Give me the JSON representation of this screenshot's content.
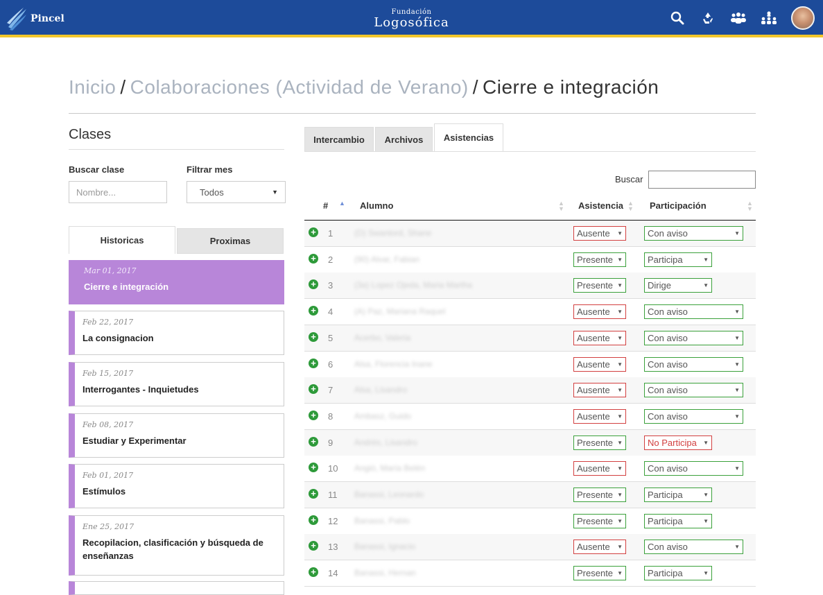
{
  "header": {
    "brand": "Pincel",
    "logo_small": "Fundación",
    "logo_big": "Logosófica",
    "icons": [
      "search-icon",
      "recycle-icon",
      "group-icon",
      "hierarchy-icon"
    ]
  },
  "breadcrumb": {
    "inicio": "Inicio",
    "sep": "/",
    "colaboraciones": "Colaboraciones (Actividad de Verano)",
    "current": "Cierre e integración"
  },
  "sidebar": {
    "title": "Clases",
    "buscar_label": "Buscar clase",
    "buscar_placeholder": "Nombre...",
    "filtrar_label": "Filtrar mes",
    "filtrar_value": "Todos",
    "tabs": [
      "Historicas",
      "Proximas"
    ],
    "classes": [
      {
        "date": "Mar 01, 2017",
        "name": "Cierre e integración"
      },
      {
        "date": "Feb 22, 2017",
        "name": "La consignacion"
      },
      {
        "date": "Feb 15, 2017",
        "name": "Interrogantes - Inquietudes"
      },
      {
        "date": "Feb 08, 2017",
        "name": "Estudiar y Experimentar"
      },
      {
        "date": "Feb 01, 2017",
        "name": "Estímulos"
      },
      {
        "date": "Ene 25, 2017",
        "name": "Recopilacion, clasificación y búsqueda de enseñanzas"
      }
    ]
  },
  "main": {
    "tabs": [
      "Intercambio",
      "Archivos",
      "Asistencias"
    ],
    "buscar_label": "Buscar",
    "columns": [
      "#",
      "Alumno",
      "Asistencia",
      "Participación"
    ],
    "rows": [
      {
        "n": "1",
        "alumno": "(D) Swanlord, Shane",
        "asistencia": "Ausente",
        "participacion": "Con aviso"
      },
      {
        "n": "2",
        "alumno": "(90) Alvar, Fabian",
        "asistencia": "Presente",
        "participacion": "Participa"
      },
      {
        "n": "3",
        "alumno": "(3a) Lopez Ojeda, Maria Martha",
        "asistencia": "Presente",
        "participacion": "Dirige"
      },
      {
        "n": "4",
        "alumno": "(A) Paz, Mariana Raquel",
        "asistencia": "Ausente",
        "participacion": "Con aviso"
      },
      {
        "n": "5",
        "alumno": "Acerbo, Valeria",
        "asistencia": "Ausente",
        "participacion": "Con aviso"
      },
      {
        "n": "6",
        "alumno": "Alsa, Florencia Inane",
        "asistencia": "Ausente",
        "participacion": "Con aviso"
      },
      {
        "n": "7",
        "alumno": "Alsa, Lisandro",
        "asistencia": "Ausente",
        "participacion": "Con aviso"
      },
      {
        "n": "8",
        "alumno": "Ambasz, Guido",
        "asistencia": "Ausente",
        "participacion": "Con aviso"
      },
      {
        "n": "9",
        "alumno": "Andrés, Lisandro",
        "asistencia": "Presente",
        "participacion": "No Participa"
      },
      {
        "n": "10",
        "alumno": "Angió, María Belén",
        "asistencia": "Ausente",
        "participacion": "Con aviso"
      },
      {
        "n": "11",
        "alumno": "Banassi, Leonardo",
        "asistencia": "Presente",
        "participacion": "Participa"
      },
      {
        "n": "12",
        "alumno": "Banassi, Pablo",
        "asistencia": "Presente",
        "participacion": "Participa"
      },
      {
        "n": "13",
        "alumno": "Banassi, Ignacio",
        "asistencia": "Ausente",
        "participacion": "Con aviso"
      },
      {
        "n": "14",
        "alumno": "Banassi, Hernan",
        "asistencia": "Presente",
        "participacion": "Participa"
      }
    ]
  },
  "colors": {
    "header_bg": "#1d4b9a",
    "header_accent": "#f2c62a",
    "class_accent": "#b886d9",
    "ausente_red": "#d23f3f",
    "presente_green": "#3aa03a"
  }
}
